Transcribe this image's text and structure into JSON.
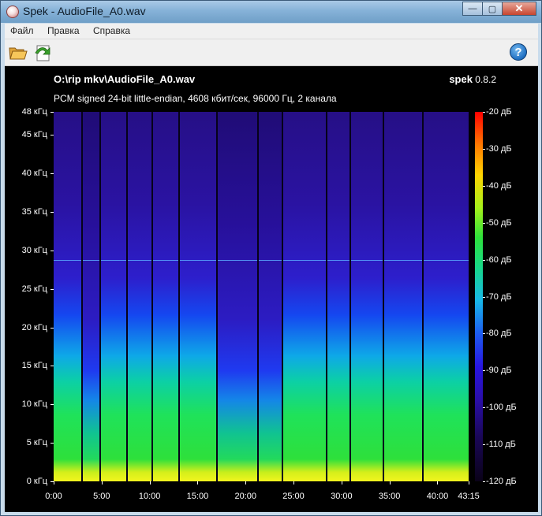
{
  "window": {
    "title": "Spek - AudioFile_A0.wav",
    "buttons": {
      "minimize": "—",
      "maximize": "▢",
      "close": "✕"
    }
  },
  "menu": {
    "items": [
      "Файл",
      "Правка",
      "Справка"
    ]
  },
  "toolbar": {
    "open_icon": "folder-open-icon",
    "save_icon": "save-image-icon",
    "help_icon": "help-icon",
    "help_glyph": "?"
  },
  "header": {
    "filename": "O:\\rip mkv\\AudioFile_A0.wav",
    "info": "PCM signed 24-bit little-endian, 4608 кбит/сек, 96000 Гц, 2 канала",
    "app_name": "spek",
    "version": "0.8.2"
  },
  "chart_data": {
    "type": "heatmap",
    "title": "",
    "y_axis": {
      "labels": [
        "48 кГц",
        "45 кГц",
        "40 кГц",
        "35 кГц",
        "30 кГц",
        "25 кГц",
        "20 кГц",
        "15 кГц",
        "10 кГц",
        "5 кГц",
        "0 кГц"
      ],
      "values": [
        48,
        45,
        40,
        35,
        30,
        25,
        20,
        15,
        10,
        5,
        0
      ],
      "range": [
        0,
        48
      ]
    },
    "x_axis": {
      "labels": [
        "0:00",
        "5:00",
        "10:00",
        "15:00",
        "20:00",
        "25:00",
        "30:00",
        "35:00",
        "40:00",
        "43:15"
      ],
      "values_sec": [
        0,
        300,
        600,
        900,
        1200,
        1500,
        1800,
        2100,
        2400,
        2595
      ],
      "range": [
        0,
        2595
      ]
    },
    "colorbar": {
      "labels": [
        "-20 дБ",
        "-30 дБ",
        "-40 дБ",
        "-50 дБ",
        "-60 дБ",
        "-70 дБ",
        "-80 дБ",
        "-90 дБ",
        "-100 дБ",
        "-110 дБ",
        "-120 дБ"
      ],
      "values": [
        -20,
        -30,
        -40,
        -50,
        -60,
        -70,
        -80,
        -90,
        -100,
        -110,
        -120
      ],
      "range": [
        -120,
        -20
      ]
    },
    "track_boundaries_sec": [
      0,
      180,
      292,
      458,
      619,
      784,
      1022,
      1279,
      1430,
      1705,
      1853,
      2063,
      2307,
      2595
    ]
  }
}
